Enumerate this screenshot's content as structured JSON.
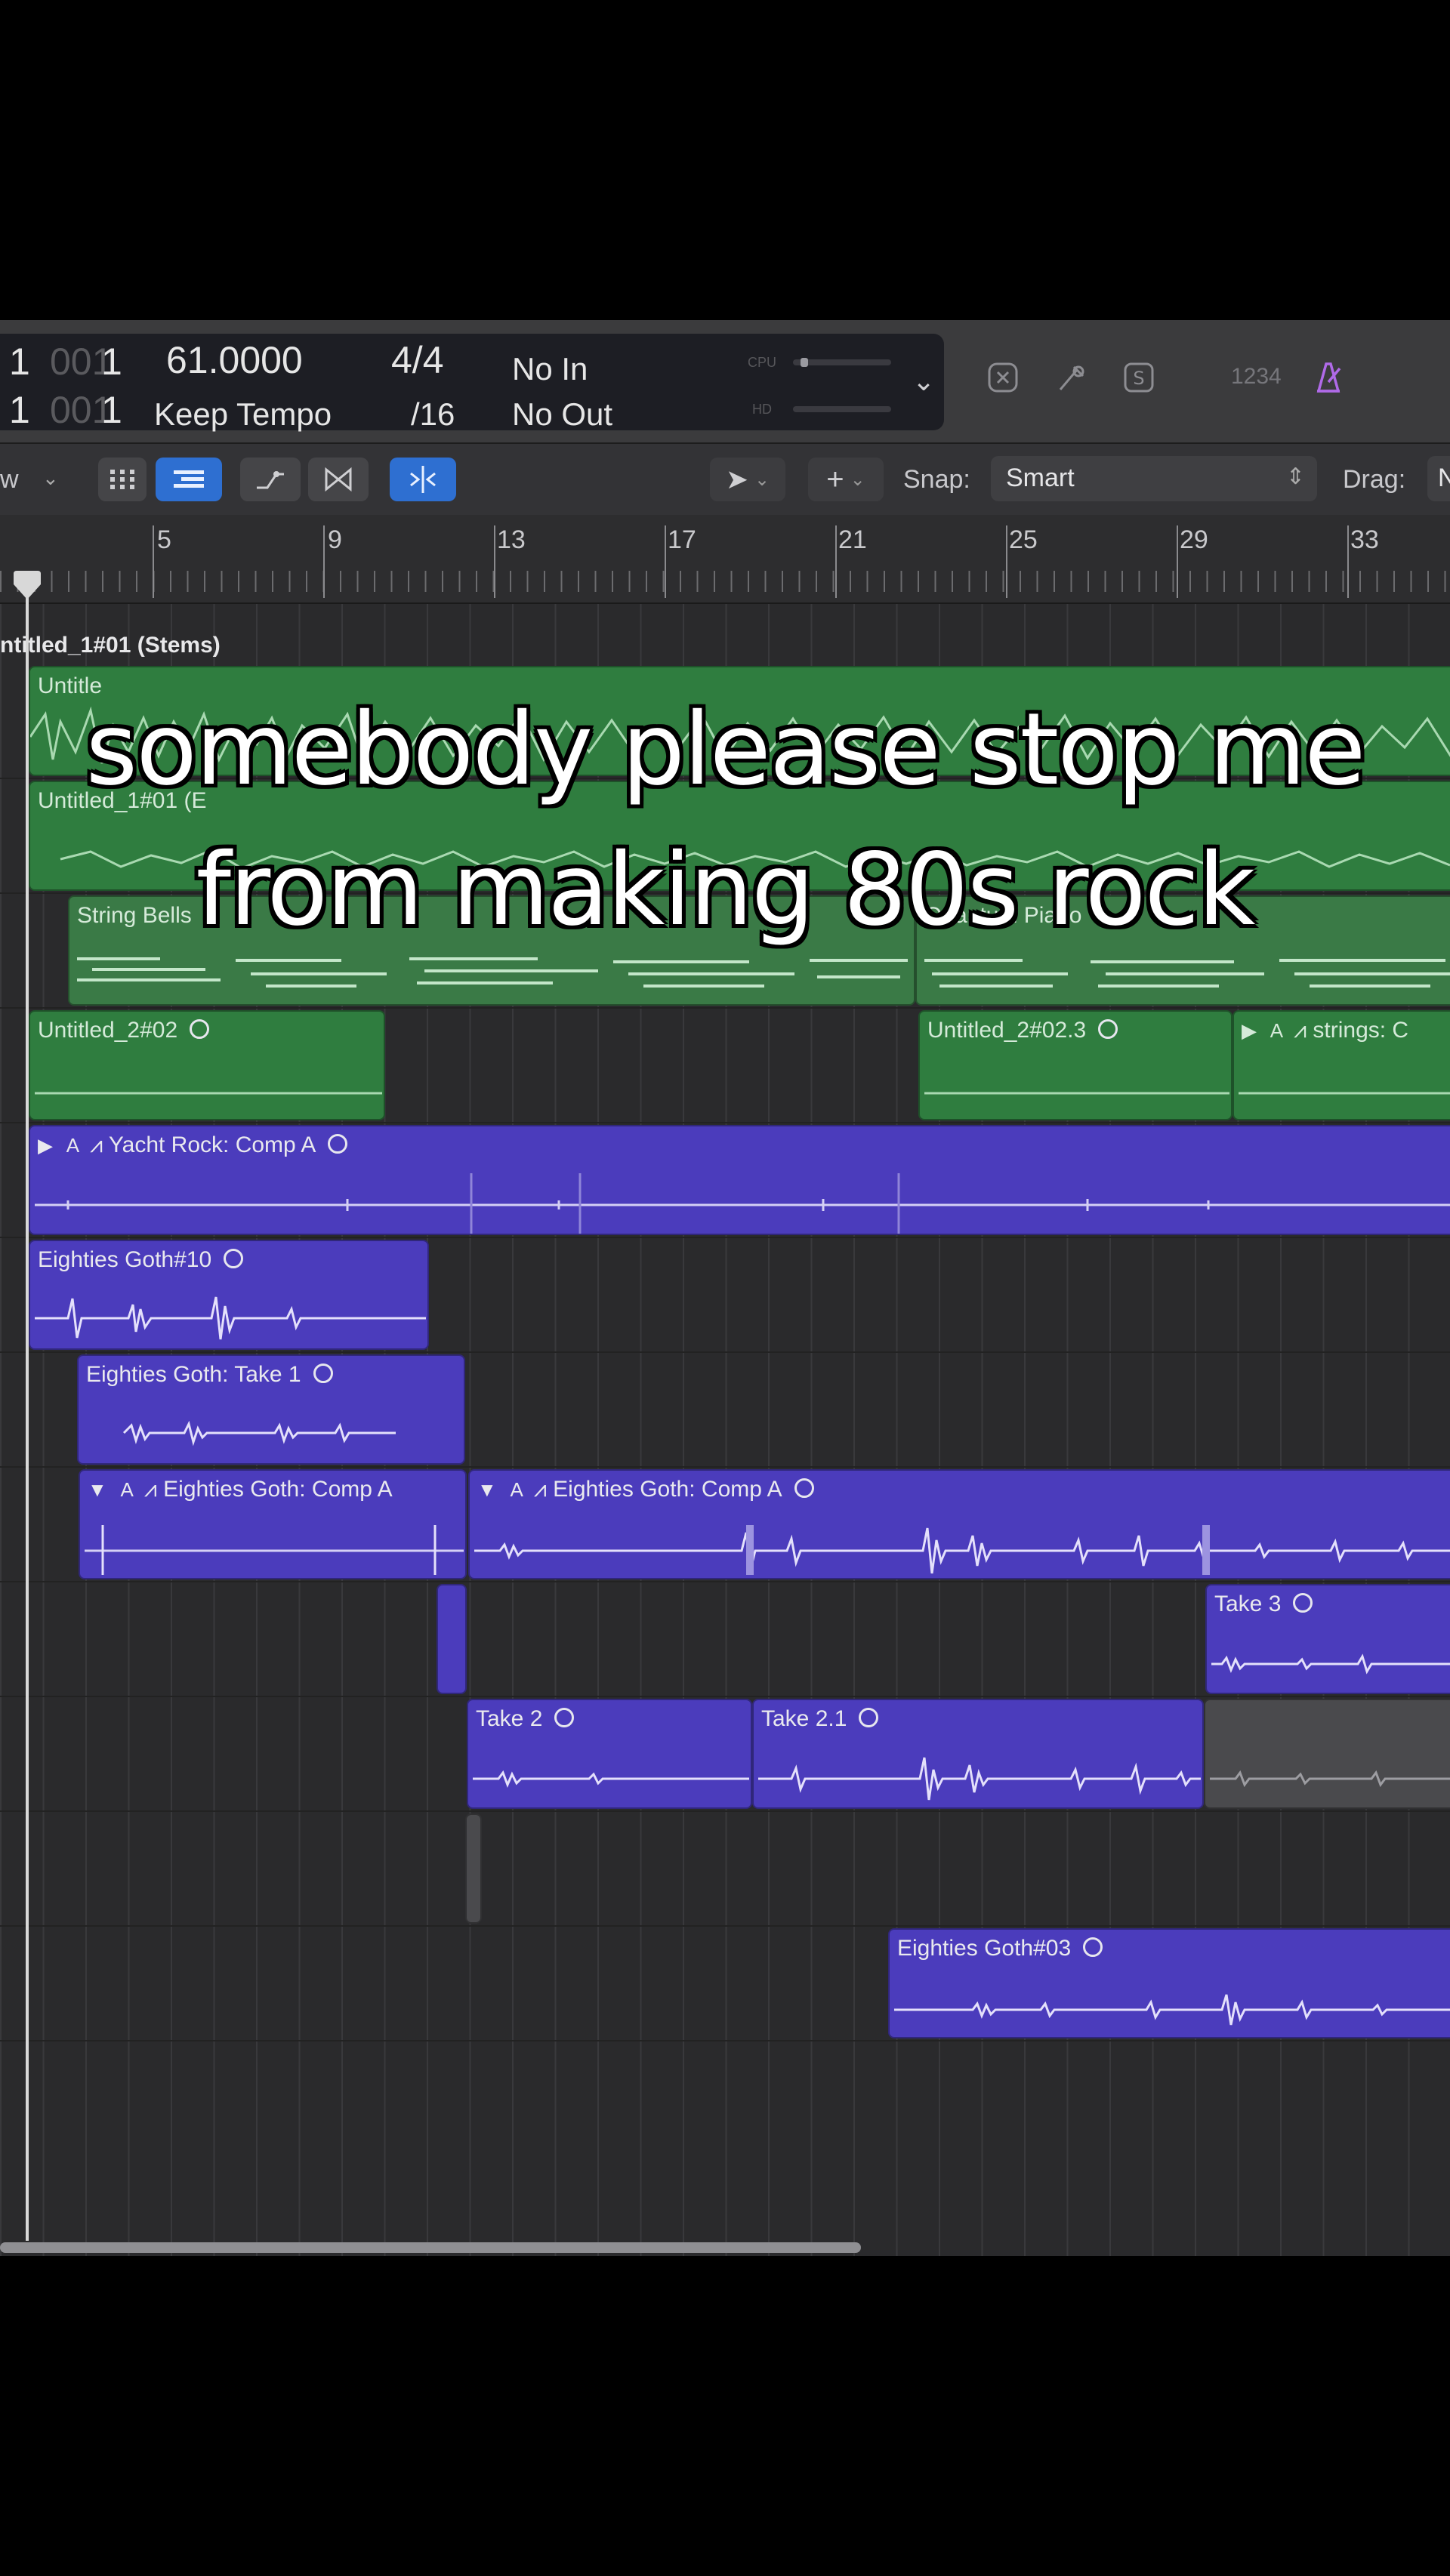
{
  "caption": {
    "line1": "somebody please stop me",
    "line2": "from making 80s rock"
  },
  "lcd": {
    "position_top_bar": "1",
    "position_top_beat": "001",
    "position_top_div": "1",
    "position_bottom_bar": "1",
    "position_bottom_beat": "001",
    "position_bottom_div": "1",
    "tempo": "61.0000",
    "tempo_mode": "Keep Tempo",
    "time_signature": "4/4",
    "division": "/16",
    "in_label": "No In",
    "out_label": "No Out",
    "cpu_label": "CPU",
    "hd_label": "HD"
  },
  "control_right": {
    "count_in": "1234"
  },
  "toolbar": {
    "view_label": "w",
    "snap_label": "Snap:",
    "snap_value": "Smart",
    "drag_label": "Drag:",
    "drag_value": "N"
  },
  "ruler": {
    "bars": [
      "5",
      "9",
      "13",
      "17",
      "21",
      "25",
      "29",
      "33"
    ]
  },
  "folder": {
    "label": "ntitled_1#01 (Stems)"
  },
  "regions": {
    "untitled_top": "Untitle",
    "untitled_1_01": "Untitled_1#01 (E",
    "string_bells": "String Bells",
    "quantum_piano": "Quantum Piano",
    "untitled_2_02": "Untitled_2#02",
    "untitled_2_02_3": "Untitled_2#02.3",
    "strings_flags": "▶ A",
    "strings": "strings: C",
    "yacht_flags": "▶ A",
    "yacht_rock": "Yacht Rock: Comp A",
    "goth_10": "Eighties Goth#10",
    "goth_take1": "Eighties Goth: Take 1",
    "goth_comp_a1_flags": "▼ A",
    "goth_comp_a1": "Eighties Goth: Comp A",
    "goth_comp_a2_flags": "▼ A",
    "goth_comp_a2": "Eighties Goth: Comp A",
    "take3": "Take 3",
    "take2": "Take 2",
    "take2_1": "Take 2.1",
    "goth_03": "Eighties Goth#03"
  },
  "colors": {
    "green_region": "#2f7d3f",
    "purple_region": "#4b3cbc",
    "accent_blue": "#2e6fd1",
    "metronome_purple": "#b06ae8"
  }
}
